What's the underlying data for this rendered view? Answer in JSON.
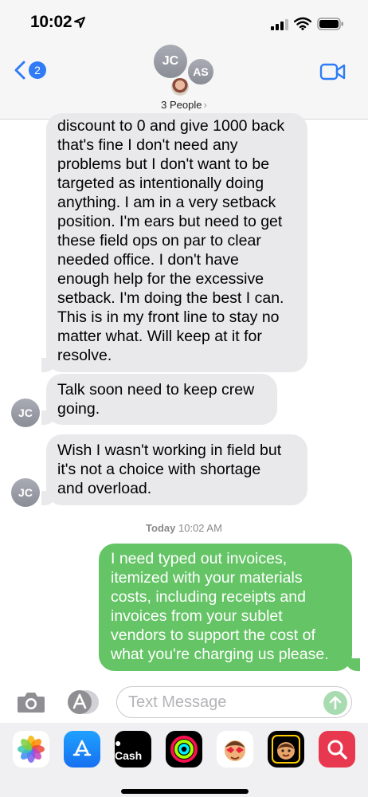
{
  "status_bar": {
    "time": "10:02"
  },
  "header": {
    "back_badge": "2",
    "avatars": [
      "JC",
      "AS"
    ],
    "group_name": "3 People",
    "chevron": "›"
  },
  "messages": [
    {
      "direction": "incoming",
      "text": "discount to 0 and give 1000 back\nthat's fine I don't need any\nproblems but I don't want to be\ntargeted as intentionally doing\nanything. I am in a very setback\nposition. I'm ears but need to get\nthese field ops on par to clear\nneeded office. I don't have\nenough help for the excessive\nsetback. I'm doing the best I can.\nThis is in my front line to stay no\nmatter what. Will keep at it for\nresolve."
    },
    {
      "direction": "incoming",
      "sender_initials": "JC",
      "text": "Talk soon need to keep crew\ngoing."
    },
    {
      "direction": "incoming",
      "sender_initials": "JC",
      "text": "Wish I wasn't working in field but\nit's not a choice with shortage\nand overload."
    },
    {
      "direction": "outgoing",
      "text": "I need typed out invoices,\nitemized with your materials\ncosts, including receipts and\ninvoices from your sublet\nvendors to support the cost of\nwhat you're charging us please."
    }
  ],
  "timestamp": {
    "day": "Today",
    "time": "10:02 AM"
  },
  "input": {
    "placeholder": "Text Message",
    "value": ""
  },
  "app_drawer": {
    "apps": [
      "photos-icon",
      "app-store-icon",
      "apple-cash-icon",
      "activity-icon",
      "memoji-icon",
      "memoji-alt-icon",
      "search-images-icon"
    ],
    "cash_label": "Cash"
  },
  "colors": {
    "incoming_bubble": "#e9e9eb",
    "outgoing_bubble": "#65c466",
    "accent": "#2f7cf6",
    "send_button": "#a8dcb0"
  }
}
